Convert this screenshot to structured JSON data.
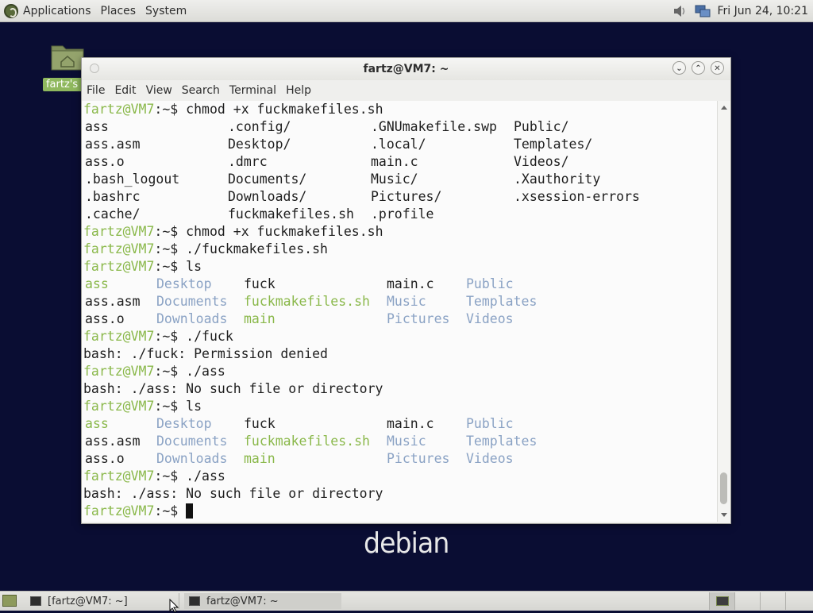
{
  "top_panel": {
    "menus": [
      "Applications",
      "Places",
      "System"
    ],
    "clock": "Fri Jun 24, 10:21"
  },
  "desktop": {
    "home_icon_label": "fartz's H"
  },
  "wallpaper_text": "debian",
  "terminal": {
    "title": "fartz@VM7: ~",
    "menus": [
      "File",
      "Edit",
      "View",
      "Search",
      "Terminal",
      "Help"
    ],
    "prompt_user": "fartz@VM7",
    "prompt_tail": ":~$ ",
    "lines": [
      {
        "type": "cmd",
        "text": "chmod +x fuckmakefiles.sh"
      },
      {
        "type": "cols",
        "cols": [
          [
            "ass",
            ""
          ],
          [
            ".config/",
            ""
          ],
          [
            ".GNUmakefile.swp",
            ""
          ],
          [
            "Public/",
            ""
          ]
        ]
      },
      {
        "type": "cols",
        "cols": [
          [
            "ass.asm",
            ""
          ],
          [
            "Desktop/",
            ""
          ],
          [
            ".local/",
            ""
          ],
          [
            "Templates/",
            ""
          ]
        ]
      },
      {
        "type": "cols",
        "cols": [
          [
            "ass.o",
            ""
          ],
          [
            ".dmrc",
            ""
          ],
          [
            "main.c",
            ""
          ],
          [
            "Videos/",
            ""
          ]
        ]
      },
      {
        "type": "cols",
        "cols": [
          [
            ".bash_logout",
            ""
          ],
          [
            "Documents/",
            ""
          ],
          [
            "Music/",
            ""
          ],
          [
            ".Xauthority",
            ""
          ]
        ]
      },
      {
        "type": "cols",
        "cols": [
          [
            ".bashrc",
            ""
          ],
          [
            "Downloads/",
            ""
          ],
          [
            "Pictures/",
            ""
          ],
          [
            ".xsession-errors",
            ""
          ]
        ]
      },
      {
        "type": "cols",
        "cols": [
          [
            ".cache/",
            ""
          ],
          [
            "fuckmakefiles.sh",
            ""
          ],
          [
            ".profile",
            ""
          ]
        ]
      },
      {
        "type": "cmd",
        "text": "chmod +x fuckmakefiles.sh"
      },
      {
        "type": "cmd",
        "text": "./fuckmakefiles.sh"
      },
      {
        "type": "cmd",
        "text": "ls"
      },
      {
        "type": "ls",
        "cols": [
          [
            "ass",
            "exec"
          ],
          [
            "Desktop",
            "dir"
          ],
          [
            "fuck",
            ""
          ],
          [
            "main.c",
            ""
          ],
          [
            "Public",
            "dir"
          ]
        ]
      },
      {
        "type": "ls",
        "cols": [
          [
            "ass.asm",
            ""
          ],
          [
            "Documents",
            "dir"
          ],
          [
            "fuckmakefiles.sh",
            "exec"
          ],
          [
            "Music",
            "dir"
          ],
          [
            "Templates",
            "dir"
          ]
        ]
      },
      {
        "type": "ls",
        "cols": [
          [
            "ass.o",
            ""
          ],
          [
            "Downloads",
            "dir"
          ],
          [
            "main",
            "exec"
          ],
          [
            "Pictures",
            "dir"
          ],
          [
            "Videos",
            "dir"
          ]
        ]
      },
      {
        "type": "cmd",
        "text": "./fuck"
      },
      {
        "type": "out",
        "text": "bash: ./fuck: Permission denied"
      },
      {
        "type": "cmd",
        "text": "./ass"
      },
      {
        "type": "out",
        "text": "bash: ./ass: No such file or directory"
      },
      {
        "type": "cmd",
        "text": "ls"
      },
      {
        "type": "ls",
        "cols": [
          [
            "ass",
            "exec"
          ],
          [
            "Desktop",
            "dir"
          ],
          [
            "fuck",
            ""
          ],
          [
            "main.c",
            ""
          ],
          [
            "Public",
            "dir"
          ]
        ]
      },
      {
        "type": "ls",
        "cols": [
          [
            "ass.asm",
            ""
          ],
          [
            "Documents",
            "dir"
          ],
          [
            "fuckmakefiles.sh",
            "exec"
          ],
          [
            "Music",
            "dir"
          ],
          [
            "Templates",
            "dir"
          ]
        ]
      },
      {
        "type": "ls",
        "cols": [
          [
            "ass.o",
            ""
          ],
          [
            "Downloads",
            "dir"
          ],
          [
            "main",
            "exec"
          ],
          [
            "Pictures",
            "dir"
          ],
          [
            "Videos",
            "dir"
          ]
        ]
      },
      {
        "type": "cmd",
        "text": "./ass"
      },
      {
        "type": "out",
        "text": "bash: ./ass: No such file or directory"
      },
      {
        "type": "prompt",
        "text": ""
      }
    ]
  },
  "taskbar": {
    "tasks": [
      "[fartz@VM7: ~]",
      "fartz@VM7: ~"
    ]
  },
  "colors": {
    "prompt": "#8ab84a",
    "executable": "#8ab84a",
    "directory": "#8aa2c4",
    "desktop_bg": "#0a0d33"
  }
}
